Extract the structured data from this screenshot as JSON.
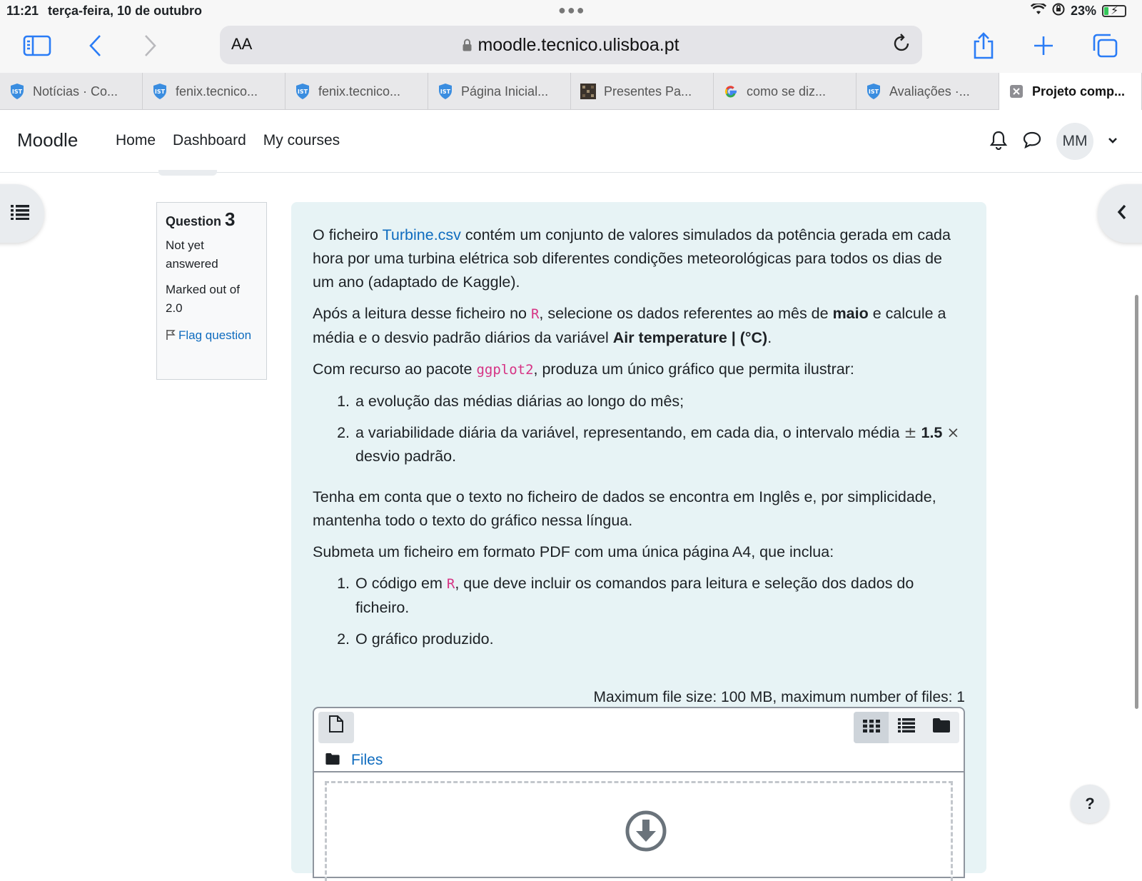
{
  "status_bar": {
    "time": "11:21",
    "date": "terça-feira, 10 de outubro",
    "battery_percent": "23%",
    "battery_level": 0.23
  },
  "browser": {
    "text_size_label": "AA",
    "url": "moodle.tecnico.ulisboa.pt",
    "accent_color": "#2a7cf6",
    "tabs": [
      {
        "title": "Notícias · Co...",
        "icon": "ist-shield-icon"
      },
      {
        "title": "fenix.tecnico...",
        "icon": "ist-shield-icon"
      },
      {
        "title": "fenix.tecnico...",
        "icon": "ist-shield-icon"
      },
      {
        "title": "Página Inicial...",
        "icon": "ist-shield-icon"
      },
      {
        "title": "Presentes Pa...",
        "icon": "mosaic-icon"
      },
      {
        "title": "como se diz...",
        "icon": "google-icon"
      },
      {
        "title": "Avaliações ·...",
        "icon": "ist-shield-icon"
      },
      {
        "title": "Projeto comp...",
        "icon": "close-tab-icon",
        "active": true
      }
    ]
  },
  "navbar": {
    "brand": "Moodle",
    "links": [
      "Home",
      "Dashboard",
      "My courses"
    ],
    "user_initials": "MM"
  },
  "question_info": {
    "label": "Question",
    "number": "3",
    "state": "Not yet answered",
    "grade": "Marked out of 2.0",
    "flag": "Flag question"
  },
  "question": {
    "p1": {
      "a": "O ficheiro ",
      "link": "Turbine.csv",
      "b": " contém um conjunto de valores simulados da potência gerada em cada hora por uma turbina elétrica sob diferentes condições meteorológicas para todos os dias de um ano (adaptado de Kaggle)."
    },
    "p2": {
      "a": "Após a leitura desse ficheiro no ",
      "code": "R",
      "b": ", selecione os dados referentes ao mês de ",
      "bold1": "maio",
      "c": " e calcule a média e o desvio padrão diários da variável ",
      "bold2": "Air temperature | (°C)",
      "d": "."
    },
    "p3": {
      "a": "Com recurso ao pacote ",
      "code": "ggplot2",
      "b": ", produza um único gráfico que permita ilustrar:"
    },
    "list1": {
      "item1": "a evolução das médias diárias ao longo do mês;",
      "item2_a": "a variabilidade diária da variável, representando, em cada dia, o intervalo média ",
      "pm": "±",
      "item2_bold": "1.5",
      "times": "×",
      "item2_b": " desvio padrão."
    },
    "p4": "Tenha em conta que o texto no ficheiro de dados se encontra em Inglês e, por simplicidade, mantenha todo o texto do gráfico nessa língua.",
    "p5": "Submeta um ficheiro em formato PDF com uma única página A4, que inclua:",
    "list2": {
      "item1_a": "O código em ",
      "item1_code": "R",
      "item1_b": ", que deve incluir os comandos para leitura e seleção dos dados do ficheiro.",
      "item2": "O gráfico produzido."
    }
  },
  "file_upload": {
    "limits": "Maximum file size: 100 MB, maximum number of files: 1",
    "path_label": "Files"
  },
  "help_label": "?"
}
